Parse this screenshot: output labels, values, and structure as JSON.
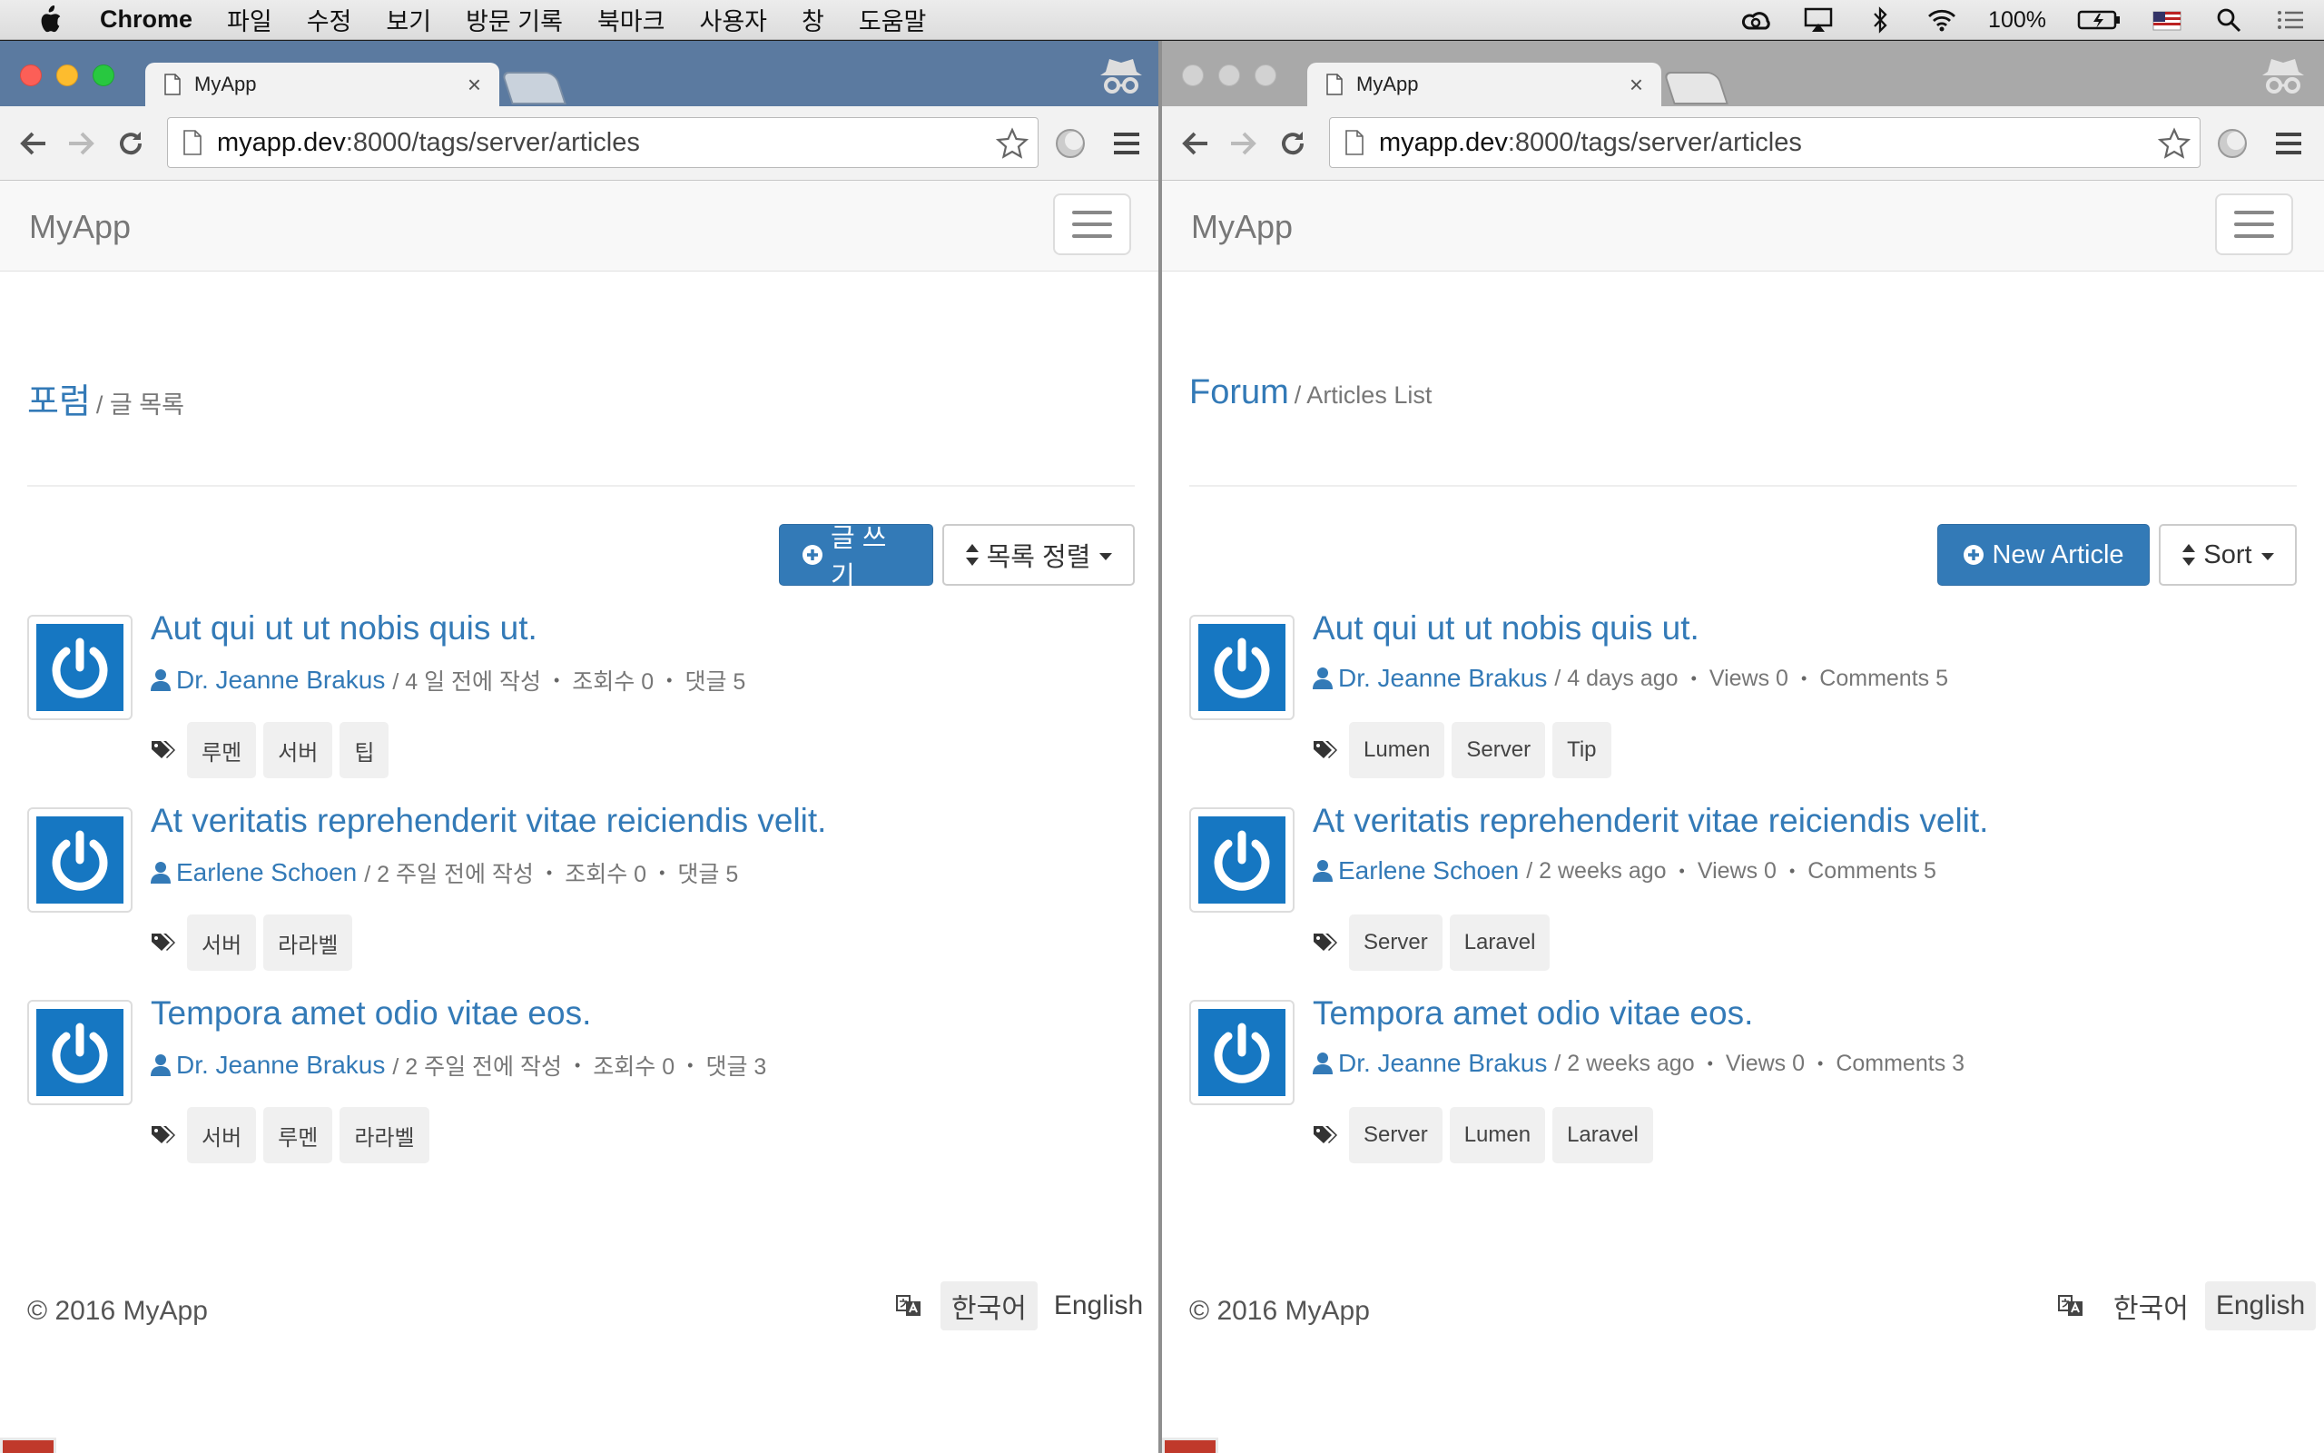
{
  "menubar": {
    "app": "Chrome",
    "items": [
      "파일",
      "수정",
      "보기",
      "방문 기록",
      "북마크",
      "사용자",
      "창",
      "도움말"
    ],
    "battery": "100%"
  },
  "windows": [
    {
      "tab": {
        "title": "MyApp"
      },
      "url": {
        "host": "myapp.dev",
        "rest": ":8000/tags/server/articles"
      },
      "brand": "MyApp",
      "breadcrumb": {
        "main": "포럼",
        "sub": "/ 글 목록"
      },
      "new_button": "글 쓰기",
      "sort_button": "목록 정렬",
      "articles": [
        {
          "title": "Aut qui ut ut nobis quis ut.",
          "author": "Dr. Jeanne Brakus",
          "when": "/ 4 일 전에 작성",
          "views": "조회수 0",
          "comments": "댓글 5",
          "tags": [
            "루멘",
            "서버",
            "팁"
          ]
        },
        {
          "title": "At veritatis reprehenderit vitae reiciendis velit.",
          "author": "Earlene Schoen",
          "when": "/ 2 주일 전에 작성",
          "views": "조회수 0",
          "comments": "댓글 5",
          "tags": [
            "서버",
            "라라벨"
          ]
        },
        {
          "title": "Tempora amet odio vitae eos.",
          "author": "Dr. Jeanne Brakus",
          "when": "/ 2 주일 전에 작성",
          "views": "조회수 0",
          "comments": "댓글 3",
          "tags": [
            "서버",
            "루멘",
            "라라벨"
          ]
        }
      ],
      "footer": {
        "copyright": "© 2016  MyApp",
        "lang_ko": "한국어",
        "lang_en": "English",
        "active": "ko"
      }
    },
    {
      "tab": {
        "title": "MyApp"
      },
      "url": {
        "host": "myapp.dev",
        "rest": ":8000/tags/server/articles"
      },
      "brand": "MyApp",
      "breadcrumb": {
        "main": "Forum",
        "sub": "/ Articles List"
      },
      "new_button": "New Article",
      "sort_button": "Sort",
      "articles": [
        {
          "title": "Aut qui ut ut nobis quis ut.",
          "author": "Dr. Jeanne Brakus",
          "when": "/ 4 days ago",
          "views": "Views 0",
          "comments": "Comments 5",
          "tags": [
            "Lumen",
            "Server",
            "Tip"
          ]
        },
        {
          "title": "At veritatis reprehenderit vitae reiciendis velit.",
          "author": "Earlene Schoen",
          "when": "/ 2 weeks ago",
          "views": "Views 0",
          "comments": "Comments 5",
          "tags": [
            "Server",
            "Laravel"
          ]
        },
        {
          "title": "Tempora amet odio vitae eos.",
          "author": "Dr. Jeanne Brakus",
          "when": "/ 2 weeks ago",
          "views": "Views 0",
          "comments": "Comments 3",
          "tags": [
            "Server",
            "Lumen",
            "Laravel"
          ]
        }
      ],
      "footer": {
        "copyright": "© 2016  MyApp",
        "lang_ko": "한국어",
        "lang_en": "English",
        "active": "en"
      }
    }
  ],
  "colors": {
    "primary": "#337ab7",
    "avatar": "#1677c2",
    "titlebar_active": "#5b7aa0",
    "titlebar_inactive": "#a9a9a9"
  }
}
